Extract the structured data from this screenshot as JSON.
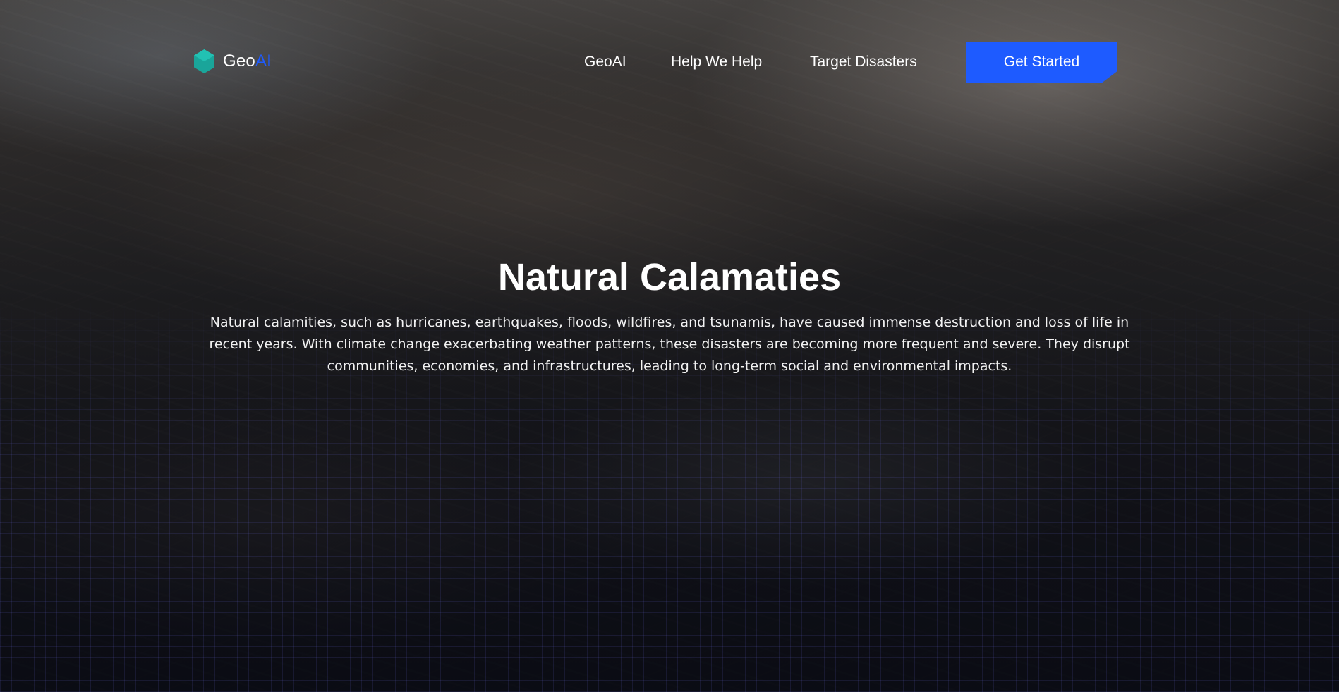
{
  "brand": {
    "name_part1": "Geo",
    "name_part2": "AI",
    "icon": "hexagon-logo-icon",
    "icon_color": "#1aa59a",
    "accent_color": "#1e5bff"
  },
  "nav": {
    "items": [
      {
        "label": "GeoAI"
      },
      {
        "label": "Help We Help"
      },
      {
        "label": "Target Disasters"
      }
    ],
    "cta_label": "Get Started"
  },
  "hero": {
    "title": "Natural Calamaties",
    "description": "Natural calamities, such as hurricanes, earthquakes, floods, wildfires, and tsunamis, have caused immense destruction and loss of life in recent years. With climate change exacerbating weather patterns, these disasters are becoming more frequent and severe. They disrupt communities, economies, and infrastructures, leading to long-term social and environmental impacts."
  }
}
